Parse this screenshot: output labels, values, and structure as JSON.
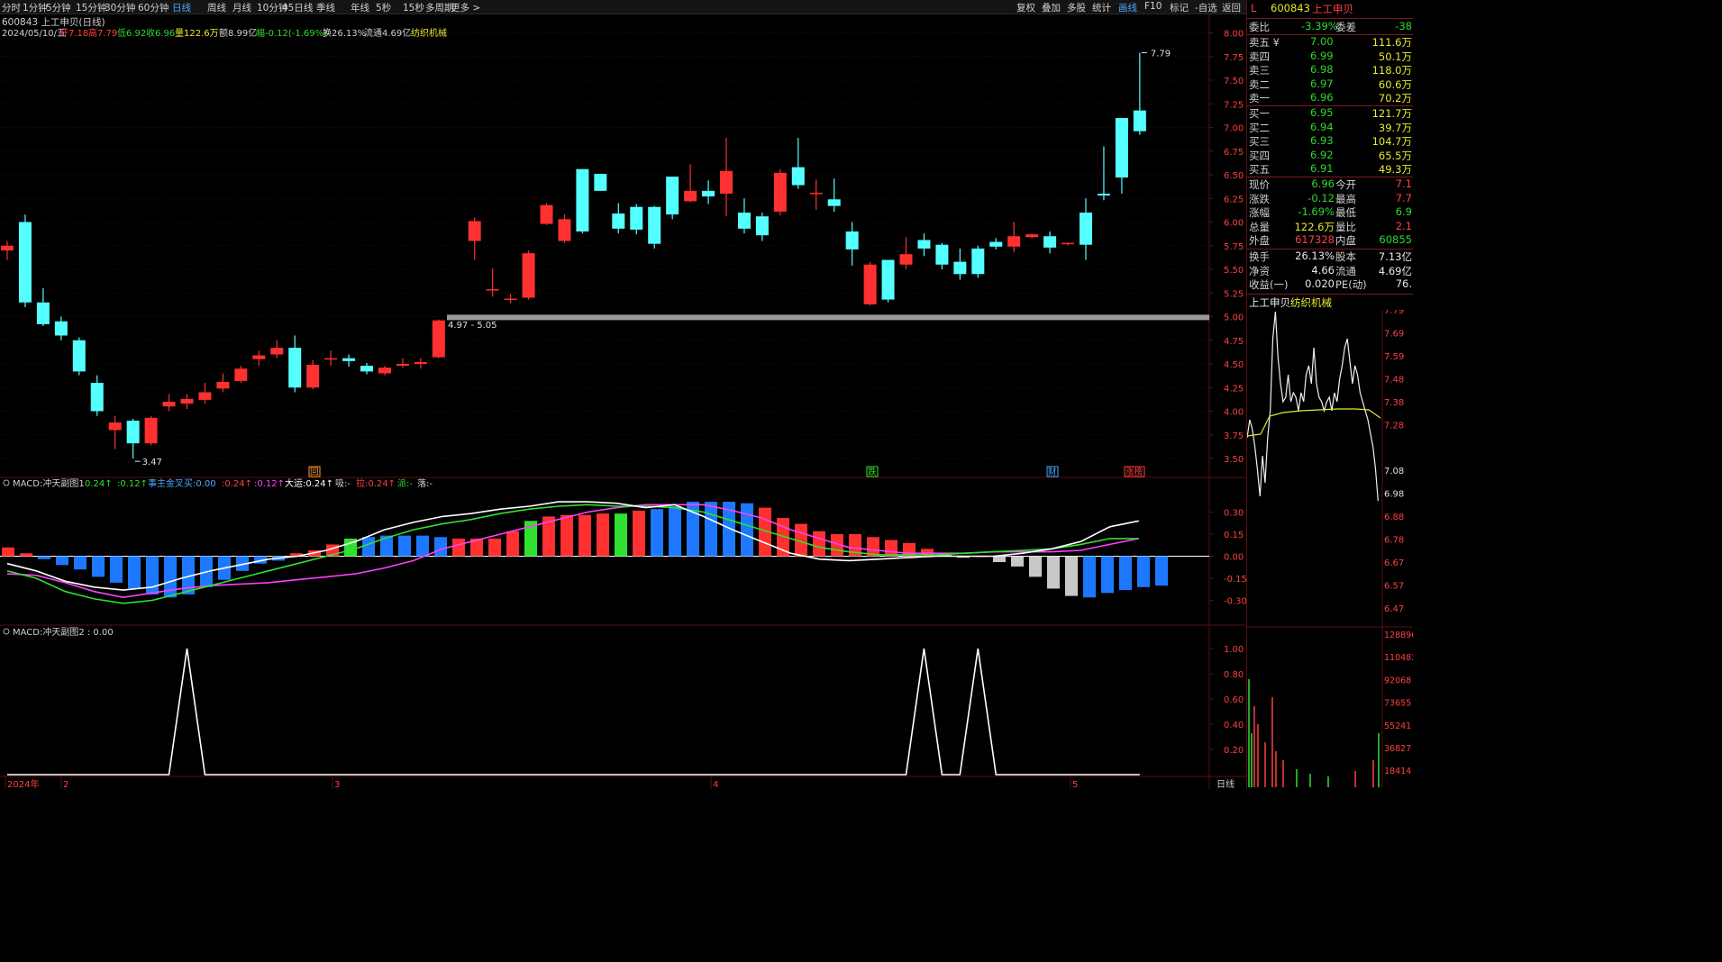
{
  "toolbar": {
    "periods": [
      "分时",
      "1分钟",
      "5分钟",
      "15分钟",
      "30分钟",
      "60分钟",
      "日线",
      "周线",
      "月线",
      "10分钟",
      "45日线",
      "季线",
      "年线",
      "5秒",
      "15秒",
      "多周期",
      "更多 >"
    ],
    "active": "日线",
    "right_buttons": [
      "复权",
      "叠加",
      "多股",
      "统计",
      "画线",
      "F10",
      "标记",
      "-自选",
      "返回"
    ],
    "active_right": "画线"
  },
  "header": {
    "stock": "600843 上工申贝(日线)",
    "date": "2024/05/10/五",
    "open": "开7.18",
    "high": "高7.79",
    "low": "低6.92",
    "close": "收6.96",
    "volume": "量122.6万",
    "amount": "额8.99亿",
    "change": "幅-0.12(-1.69%)",
    "turnover": "换26.13%",
    "float": "流通4.69亿",
    "sector": "纺织机械"
  },
  "colors": {
    "up": "#ff3030",
    "down": "#54ffff",
    "white": "#ffffff",
    "yellow": "#ffff00",
    "magenta": "#ff40ff",
    "green": "#30e030",
    "blue": "#1e78ff",
    "pink": "#ff9999",
    "gray": "#808080",
    "grid": "#5a1010"
  },
  "chart_data": [
    {
      "type": "candlestick",
      "title": "600843 上工申贝(日线)",
      "ylim": [
        3.3,
        8.1
      ],
      "y_ticks": [
        "8.00",
        "7.75",
        "7.50",
        "7.25",
        "7.00",
        "6.75",
        "6.50",
        "6.25",
        "6.00",
        "5.75",
        "5.50",
        "5.25",
        "5.00",
        "4.75",
        "4.50",
        "4.25",
        "4.00",
        "3.75",
        "3.50"
      ],
      "ohlc": [
        [
          5.7,
          5.8,
          5.6,
          5.75
        ],
        [
          6.0,
          6.08,
          5.1,
          5.15
        ],
        [
          5.15,
          5.3,
          4.9,
          4.92
        ],
        [
          4.95,
          5.0,
          4.75,
          4.8
        ],
        [
          4.75,
          4.78,
          4.38,
          4.42
        ],
        [
          4.3,
          4.38,
          3.95,
          4.0
        ],
        [
          3.8,
          3.95,
          3.6,
          3.88
        ],
        [
          3.9,
          3.92,
          3.5,
          3.66
        ],
        [
          3.66,
          3.95,
          3.64,
          3.93
        ],
        [
          4.05,
          4.18,
          4.0,
          4.1
        ],
        [
          4.08,
          4.18,
          4.02,
          4.13
        ],
        [
          4.12,
          4.3,
          4.08,
          4.2
        ],
        [
          4.24,
          4.4,
          4.2,
          4.31
        ],
        [
          4.32,
          4.48,
          4.3,
          4.45
        ],
        [
          4.55,
          4.64,
          4.48,
          4.59
        ],
        [
          4.6,
          4.75,
          4.56,
          4.67
        ],
        [
          4.67,
          4.8,
          4.2,
          4.25
        ],
        [
          4.25,
          4.54,
          4.23,
          4.49
        ],
        [
          4.56,
          4.64,
          4.48,
          4.56
        ],
        [
          4.56,
          4.6,
          4.47,
          4.53
        ],
        [
          4.48,
          4.51,
          4.39,
          4.42
        ],
        [
          4.4,
          4.48,
          4.38,
          4.46
        ],
        [
          4.48,
          4.56,
          4.46,
          4.5
        ],
        [
          4.5,
          4.56,
          4.45,
          4.52
        ],
        [
          4.57,
          4.97,
          4.56,
          4.96
        ],
        [
          5.0,
          5.0,
          5.0,
          5.0
        ],
        [
          5.8,
          6.05,
          5.6,
          6.01
        ],
        [
          5.29,
          5.51,
          5.21,
          5.29
        ],
        [
          5.19,
          5.24,
          5.14,
          5.19
        ],
        [
          5.2,
          5.7,
          5.18,
          5.67
        ],
        [
          5.98,
          6.2,
          5.97,
          6.18
        ],
        [
          5.8,
          6.08,
          5.78,
          6.03
        ],
        [
          6.56,
          6.56,
          5.88,
          5.9
        ],
        [
          6.51,
          6.51,
          6.33,
          6.33
        ],
        [
          6.09,
          6.2,
          5.88,
          5.93
        ],
        [
          6.16,
          6.19,
          5.87,
          5.92
        ],
        [
          6.16,
          6.17,
          5.72,
          5.77
        ],
        [
          6.48,
          6.48,
          6.03,
          6.08
        ],
        [
          6.22,
          6.61,
          6.21,
          6.33
        ],
        [
          6.33,
          6.44,
          6.19,
          6.27
        ],
        [
          6.3,
          6.89,
          6.06,
          6.54
        ],
        [
          6.1,
          6.25,
          5.88,
          5.93
        ],
        [
          6.06,
          6.1,
          5.8,
          5.86
        ],
        [
          6.11,
          6.56,
          6.07,
          6.52
        ],
        [
          6.58,
          6.89,
          6.35,
          6.39
        ],
        [
          6.31,
          6.45,
          6.13,
          6.31
        ],
        [
          6.24,
          6.46,
          6.11,
          6.17
        ],
        [
          5.9,
          6.0,
          5.54,
          5.71
        ],
        [
          5.13,
          5.58,
          5.12,
          5.55
        ],
        [
          5.6,
          5.6,
          5.15,
          5.18
        ],
        [
          5.55,
          5.84,
          5.5,
          5.66
        ],
        [
          5.81,
          5.88,
          5.64,
          5.72
        ],
        [
          5.76,
          5.78,
          5.5,
          5.55
        ],
        [
          5.58,
          5.72,
          5.39,
          5.45
        ],
        [
          5.72,
          5.75,
          5.41,
          5.45
        ],
        [
          5.79,
          5.83,
          5.71,
          5.74
        ],
        [
          5.74,
          6.0,
          5.68,
          5.85
        ],
        [
          5.84,
          5.88,
          5.83,
          5.87
        ],
        [
          5.85,
          5.9,
          5.67,
          5.73
        ],
        [
          5.78,
          5.78,
          5.75,
          5.78
        ],
        [
          6.1,
          6.25,
          5.6,
          5.76
        ],
        [
          6.3,
          6.8,
          6.23,
          6.28
        ],
        [
          7.1,
          7.1,
          6.3,
          6.47
        ],
        [
          7.18,
          7.79,
          6.92,
          6.96
        ]
      ],
      "annotations": [
        "7.79",
        "3.47",
        "4.97 - 5.05"
      ],
      "markers": [
        "回",
        "跌",
        "财",
        "涨榜"
      ]
    },
    {
      "type": "bar+line",
      "title": "MACD:冲天副图1",
      "labels": [
        "0.24↑",
        ":0.12↑",
        "事主金叉买:0.00",
        ":0.24↑",
        ":0.12↑",
        "大运:0.24↑",
        "吸:-",
        "拉:0.24↑",
        "派:-",
        "落:-"
      ],
      "ylim": [
        -0.45,
        0.45
      ],
      "y_ticks": [
        "0.30",
        "0.15",
        "0.00",
        "-0.15",
        "-0.30"
      ],
      "histogram": [
        0.06,
        0.02,
        -0.02,
        -0.06,
        -0.09,
        -0.14,
        -0.18,
        -0.22,
        -0.26,
        -0.28,
        -0.26,
        -0.21,
        -0.16,
        -0.1,
        -0.05,
        -0.03,
        0.02,
        0.04,
        0.08,
        0.12,
        0.13,
        0.14,
        0.14,
        0.14,
        0.13,
        0.12,
        0.12,
        0.12,
        0.17,
        0.24,
        0.27,
        0.28,
        0.28,
        0.29,
        0.29,
        0.31,
        0.32,
        0.34,
        0.37,
        0.37,
        0.37,
        0.36,
        0.33,
        0.26,
        0.22,
        0.17,
        0.15,
        0.15,
        0.13,
        0.11,
        0.09,
        0.05,
        0.01,
        -0.01,
        0.0,
        -0.04,
        -0.07,
        -0.14,
        -0.22,
        -0.27,
        -0.28,
        -0.25,
        -0.23,
        -0.21,
        -0.2,
        -0.19,
        -0.18,
        -0.17,
        -0.16,
        -0.14,
        -0.12,
        -0.11,
        -0.09,
        -0.09,
        -0.08,
        -0.07,
        -0.07,
        -0.07,
        -0.07,
        -0.07,
        -0.03,
        0.0,
        0.04,
        0.08,
        0.13,
        0.2,
        0.24,
        0.25
      ],
      "line1": [
        -0.05,
        -0.1,
        -0.17,
        -0.21,
        -0.23,
        -0.21,
        -0.15,
        -0.1,
        -0.06,
        -0.02,
        0.0,
        0.04,
        0.1,
        0.18,
        0.23,
        0.27,
        0.29,
        0.32,
        0.34,
        0.37,
        0.37,
        0.36,
        0.33,
        0.35,
        0.27,
        0.18,
        0.1,
        0.02,
        -0.02,
        -0.03,
        -0.02,
        -0.01,
        0.0,
        0.0,
        0.0,
        0.02,
        0.05,
        0.1,
        0.2,
        0.24
      ],
      "line2": [
        -0.1,
        -0.15,
        -0.24,
        -0.29,
        -0.32,
        -0.3,
        -0.25,
        -0.2,
        -0.15,
        -0.1,
        -0.05,
        0.0,
        0.05,
        0.12,
        0.18,
        0.22,
        0.25,
        0.29,
        0.32,
        0.34,
        0.35,
        0.34,
        0.34,
        0.33,
        0.3,
        0.24,
        0.18,
        0.12,
        0.06,
        0.03,
        0.01,
        0.01,
        0.01,
        0.02,
        0.03,
        0.04,
        0.05,
        0.08,
        0.12,
        0.12
      ],
      "line3": [
        -0.12,
        -0.13,
        -0.18,
        -0.24,
        -0.28,
        -0.25,
        -0.22,
        -0.2,
        -0.19,
        -0.18,
        -0.16,
        -0.14,
        -0.12,
        -0.08,
        -0.03,
        0.05,
        0.1,
        0.15,
        0.2,
        0.25,
        0.3,
        0.33,
        0.35,
        0.35,
        0.35,
        0.31,
        0.26,
        0.18,
        0.12,
        0.06,
        0.04,
        0.02,
        0.02,
        0.02,
        0.03,
        0.03,
        0.03,
        0.04,
        0.08,
        0.12
      ]
    },
    {
      "type": "line",
      "title": "MACD:冲天副图2 : 0.00",
      "ylim": [
        0,
        1.1
      ],
      "y_ticks": [
        "1.00",
        "0.80",
        "0.60",
        "0.40",
        "0.20"
      ],
      "x_ticks": [
        "2024年",
        "2",
        "3",
        "4",
        "5"
      ],
      "spikes_at": [
        10,
        51,
        54
      ],
      "values_len": 64
    }
  ],
  "sidebar": {
    "title_code": "600843",
    "title_name": "上工申贝",
    "title_prefix": "L",
    "weibi": {
      "label": "委比",
      "value": "-3.39%",
      "label2": "委差",
      "value2": "-38"
    },
    "asks": [
      {
        "label": "卖五 ¥",
        "price": "7.00",
        "vol": "111.6万"
      },
      {
        "label": "卖四",
        "price": "6.99",
        "vol": "50.1万"
      },
      {
        "label": "卖三",
        "price": "6.98",
        "vol": "118.0万"
      },
      {
        "label": "卖二",
        "price": "6.97",
        "vol": "60.6万"
      },
      {
        "label": "卖一",
        "price": "6.96",
        "vol": "70.2万"
      }
    ],
    "bids": [
      {
        "label": "买一",
        "price": "6.95",
        "vol": "121.7万"
      },
      {
        "label": "买二",
        "price": "6.94",
        "vol": "39.7万"
      },
      {
        "label": "买三",
        "price": "6.93",
        "vol": "104.7万"
      },
      {
        "label": "买四",
        "price": "6.92",
        "vol": "65.5万"
      },
      {
        "label": "买五",
        "price": "6.91",
        "vol": "49.3万"
      }
    ],
    "stats": [
      {
        "l1": "现价",
        "v1": "6.96",
        "c1": "grn",
        "l2": "今开",
        "v2": "7.1",
        "c2": "red"
      },
      {
        "l1": "涨跌",
        "v1": "-0.12",
        "c1": "grn",
        "l2": "最高",
        "v2": "7.7",
        "c2": "red"
      },
      {
        "l1": "涨幅",
        "v1": "-1.69%",
        "c1": "grn",
        "l2": "最低",
        "v2": "6.9",
        "c2": "grn"
      },
      {
        "l1": "总量",
        "v1": "122.6万",
        "c1": "yel",
        "l2": "量比",
        "v2": "2.1",
        "c2": "red"
      },
      {
        "l1": "外盘",
        "v1": "617328",
        "c1": "red",
        "l2": "内盘",
        "v2": "60855",
        "c2": "grn"
      }
    ],
    "stats2": [
      {
        "l1": "换手",
        "v1": "26.13%",
        "l2": "股本",
        "v2": "7.13亿"
      },
      {
        "l1": "净资",
        "v1": "4.66",
        "l2": "流通",
        "v2": "4.69亿"
      },
      {
        "l1": "收益(一)",
        "v1": "0.020",
        "l2": "PE(动)",
        "v2": "76."
      }
    ],
    "mini_title": "上工申贝",
    "mini_sector": "纺织机械",
    "mini_y_ticks": [
      "7.79",
      "7.69",
      "7.59",
      "7.48",
      "7.38",
      "7.28",
      "7.08",
      "6.98",
      "6.88",
      "6.78",
      "6.67",
      "6.57",
      "6.47"
    ],
    "mini_vol_ticks": [
      "128896",
      "110482",
      "92068",
      "73655",
      "55241",
      "36827",
      "18414"
    ]
  },
  "footer": {
    "period_label": "日线"
  }
}
